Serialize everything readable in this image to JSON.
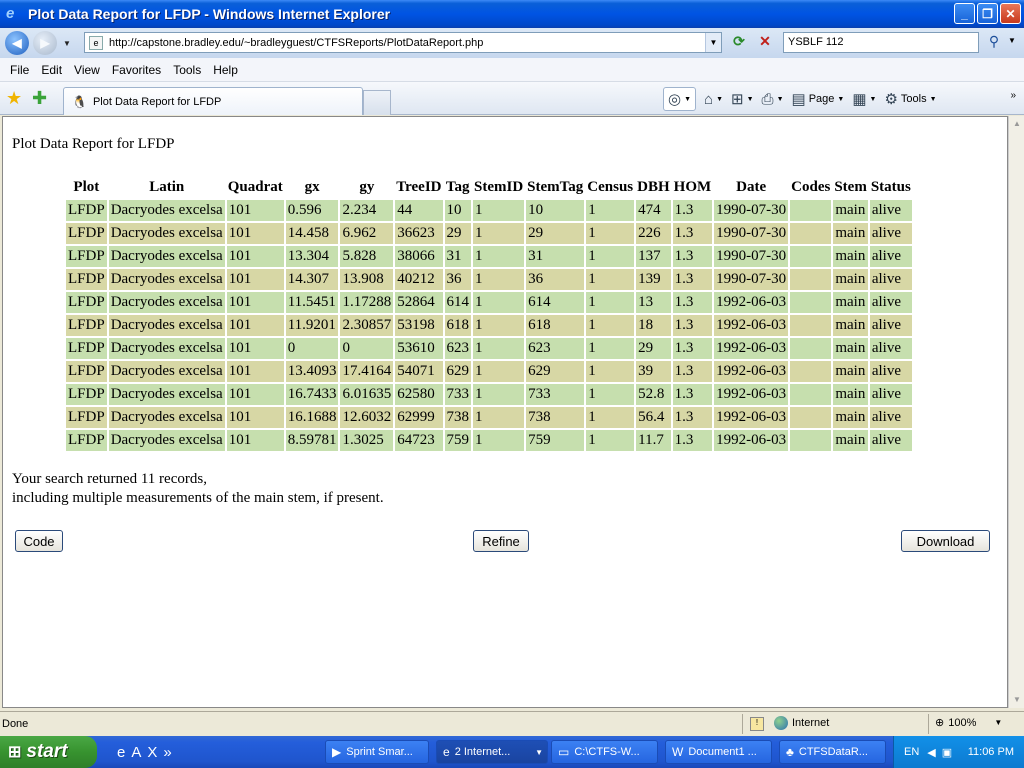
{
  "window": {
    "title": "Plot Data Report for LFDP - Windows Internet Explorer",
    "address": "http://capstone.bradley.edu/~bradleyguest/CTFSReports/PlotDataReport.php",
    "search_value": "YSBLF 112"
  },
  "menu": [
    "File",
    "Edit",
    "View",
    "Favorites",
    "Tools",
    "Help"
  ],
  "tab": {
    "label": "Plot Data Report for LFDP"
  },
  "command_bar": {
    "page_label": "Page",
    "tools_label": "Tools"
  },
  "page": {
    "title": "Plot Data Report for LFDP",
    "columns": [
      "Plot",
      "Latin",
      "Quadrat",
      "gx",
      "gy",
      "TreeID",
      "Tag",
      "StemID",
      "StemTag",
      "Census",
      "DBH",
      "HOM",
      "Date",
      "Codes",
      "Stem",
      "Status"
    ],
    "rows": [
      [
        "LFDP",
        "Dacryodes excelsa",
        "101",
        "0.596",
        "2.234",
        "44",
        "10",
        "1",
        "10",
        "1",
        "474",
        "1.3",
        "1990-07-30",
        "",
        "main",
        "alive"
      ],
      [
        "LFDP",
        "Dacryodes excelsa",
        "101",
        "14.458",
        "6.962",
        "36623",
        "29",
        "1",
        "29",
        "1",
        "226",
        "1.3",
        "1990-07-30",
        "",
        "main",
        "alive"
      ],
      [
        "LFDP",
        "Dacryodes excelsa",
        "101",
        "13.304",
        "5.828",
        "38066",
        "31",
        "1",
        "31",
        "1",
        "137",
        "1.3",
        "1990-07-30",
        "",
        "main",
        "alive"
      ],
      [
        "LFDP",
        "Dacryodes excelsa",
        "101",
        "14.307",
        "13.908",
        "40212",
        "36",
        "1",
        "36",
        "1",
        "139",
        "1.3",
        "1990-07-30",
        "",
        "main",
        "alive"
      ],
      [
        "LFDP",
        "Dacryodes excelsa",
        "101",
        "11.5451",
        "1.17288",
        "52864",
        "614",
        "1",
        "614",
        "1",
        "13",
        "1.3",
        "1992-06-03",
        "",
        "main",
        "alive"
      ],
      [
        "LFDP",
        "Dacryodes excelsa",
        "101",
        "11.9201",
        "2.30857",
        "53198",
        "618",
        "1",
        "618",
        "1",
        "18",
        "1.3",
        "1992-06-03",
        "",
        "main",
        "alive"
      ],
      [
        "LFDP",
        "Dacryodes excelsa",
        "101",
        "0",
        "0",
        "53610",
        "623",
        "1",
        "623",
        "1",
        "29",
        "1.3",
        "1992-06-03",
        "",
        "main",
        "alive"
      ],
      [
        "LFDP",
        "Dacryodes excelsa",
        "101",
        "13.4093",
        "17.4164",
        "54071",
        "629",
        "1",
        "629",
        "1",
        "39",
        "1.3",
        "1992-06-03",
        "",
        "main",
        "alive"
      ],
      [
        "LFDP",
        "Dacryodes excelsa",
        "101",
        "16.7433",
        "6.01635",
        "62580",
        "733",
        "1",
        "733",
        "1",
        "52.8",
        "1.3",
        "1992-06-03",
        "",
        "main",
        "alive"
      ],
      [
        "LFDP",
        "Dacryodes excelsa",
        "101",
        "16.1688",
        "12.6032",
        "62999",
        "738",
        "1",
        "738",
        "1",
        "56.4",
        "1.3",
        "1992-06-03",
        "",
        "main",
        "alive"
      ],
      [
        "LFDP",
        "Dacryodes excelsa",
        "101",
        "8.59781",
        "1.3025",
        "64723",
        "759",
        "1",
        "759",
        "1",
        "11.7",
        "1.3",
        "1992-06-03",
        "",
        "main",
        "alive"
      ]
    ],
    "summary_line1": "Your search returned 11 records,",
    "summary_line2": "including multiple measurements of the main stem, if present.",
    "buttons": {
      "code": "Code",
      "refine": "Refine",
      "download": "Download"
    }
  },
  "status": {
    "text": "Done",
    "zone": "Internet",
    "zoom": "100%"
  },
  "taskbar": {
    "start": "start",
    "tasks": [
      "Sprint Smar...",
      "2 Internet...",
      "C:\\CTFS-W...",
      "Document1 ...",
      "CTFSDataR..."
    ],
    "lang": "EN",
    "time": "11:06 PM"
  },
  "colors": {
    "row_odd": "#c6dfae",
    "row_even": "#d7d7a5",
    "titlebar": "#0054e3"
  }
}
